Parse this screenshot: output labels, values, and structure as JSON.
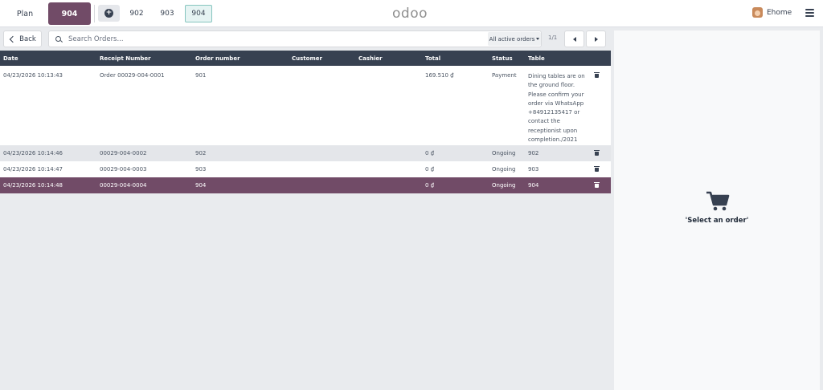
{
  "navbar": {
    "plan_label": "Plan",
    "active_table": "904",
    "order_tabs": [
      "902",
      "903",
      "904"
    ],
    "logo": "odoo",
    "user_name": "Ehome"
  },
  "toolbar": {
    "back_label": "Back",
    "search_placeholder": "Search Orders...",
    "filter_label": "All active orders",
    "pager": "1/1"
  },
  "table": {
    "headers": {
      "date": "Date",
      "receipt": "Receipt Number",
      "order": "Order number",
      "customer": "Customer",
      "cashier": "Cashier",
      "total": "Total",
      "status": "Status",
      "table": "Table"
    },
    "rows": [
      {
        "date": "04/23/2026 10:13:43",
        "receipt": "Order 00029-004-0001",
        "order": "901",
        "customer": "",
        "cashier": "",
        "total": "169.510 ₫",
        "status": "Payment",
        "table": "Dining tables are on the ground floor. Please confirm your order via WhatsApp +84912135417 or contact the receptionist upon completion./2021"
      },
      {
        "date": "04/23/2026 10:14:46",
        "receipt": "00029-004-0002",
        "order": "902",
        "customer": "",
        "cashier": "",
        "total": "0 ₫",
        "status": "Ongoing",
        "table": "902"
      },
      {
        "date": "04/23/2026 10:14:47",
        "receipt": "00029-004-0003",
        "order": "903",
        "customer": "",
        "cashier": "",
        "total": "0 ₫",
        "status": "Ongoing",
        "table": "903"
      },
      {
        "date": "04/23/2026 10:14:48",
        "receipt": "00029-004-0004",
        "order": "904",
        "customer": "",
        "cashier": "",
        "total": "0 ₫",
        "status": "Ongoing",
        "table": "904"
      }
    ]
  },
  "detail": {
    "empty_message": "'Select an order'"
  },
  "colors": {
    "brand": "#714b67",
    "header_bg": "#374151"
  }
}
